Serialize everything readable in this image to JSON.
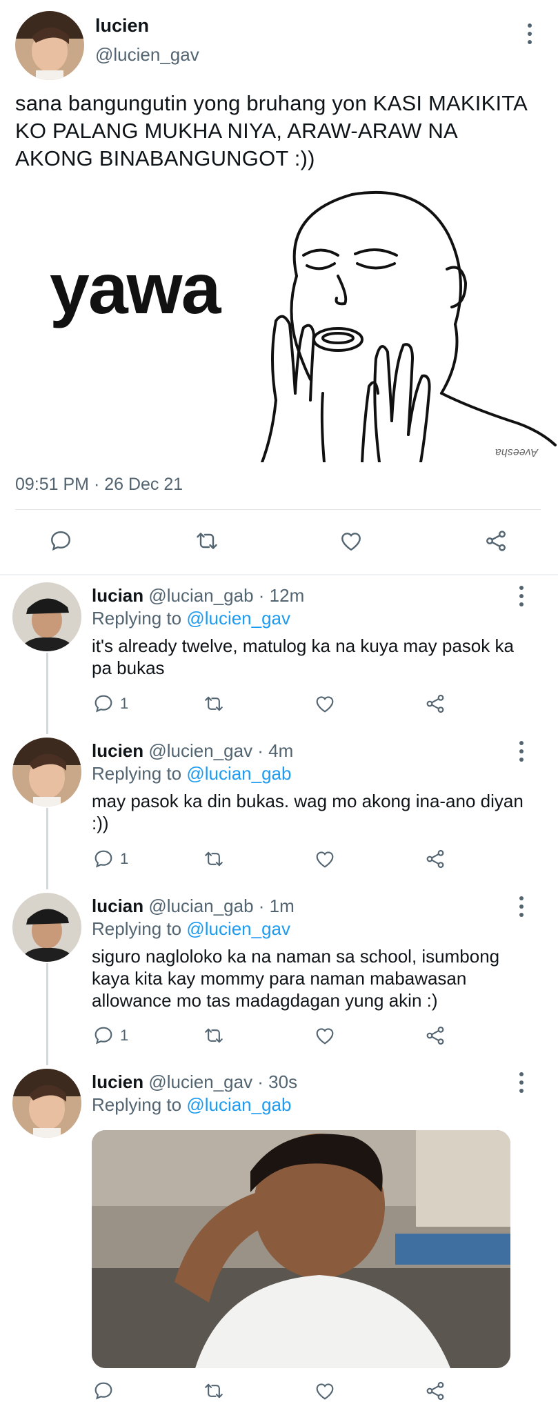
{
  "main_tweet": {
    "name": "lucien",
    "handle": "@lucien_gav",
    "text": "sana bangungutin yong bruhang yon KASI MAKIKITA KO PALANG MUKHA NIYA, ARAW-ARAW NA AKONG BINABANGUNGOT :))",
    "meme_word": "yawa",
    "meme_watermark": "Aveesha",
    "timestamp": "09:51 PM · 26 Dec 21",
    "actions": [
      "reply-icon",
      "retweet-icon",
      "like-icon",
      "share-icon"
    ]
  },
  "replies": [
    {
      "name": "lucian",
      "handle": "@lucian_gab · 12m",
      "replying_prefix": "Replying to ",
      "replying_to": "@lucien_gav",
      "text": "it's already twelve, matulog ka na kuya may pasok ka pa bukas",
      "reply_count": "1"
    },
    {
      "name": "lucien",
      "handle": "@lucien_gav · 4m",
      "replying_prefix": "Replying to ",
      "replying_to": "@lucian_gab",
      "text": "may pasok ka din bukas. wag mo akong ina-ano diyan :))",
      "reply_count": "1"
    },
    {
      "name": "lucian",
      "handle": "@lucian_gab · 1m",
      "replying_prefix": "Replying to ",
      "replying_to": "@lucien_gav",
      "text": "siguro nagloloko ka na naman sa school, isumbong kaya kita kay mommy para naman mabawasan allowance mo tas madagdagan yung akin :)",
      "reply_count": "1"
    },
    {
      "name": "lucien",
      "handle": "@lucien_gav · 30s",
      "replying_prefix": "Replying to ",
      "replying_to": "@lucian_gab",
      "text": "",
      "reply_count": ""
    }
  ],
  "colors": {
    "text": "#0f1419",
    "secondary": "#536471",
    "accent": "#1d9bf0",
    "divider": "#e3e6e8"
  }
}
